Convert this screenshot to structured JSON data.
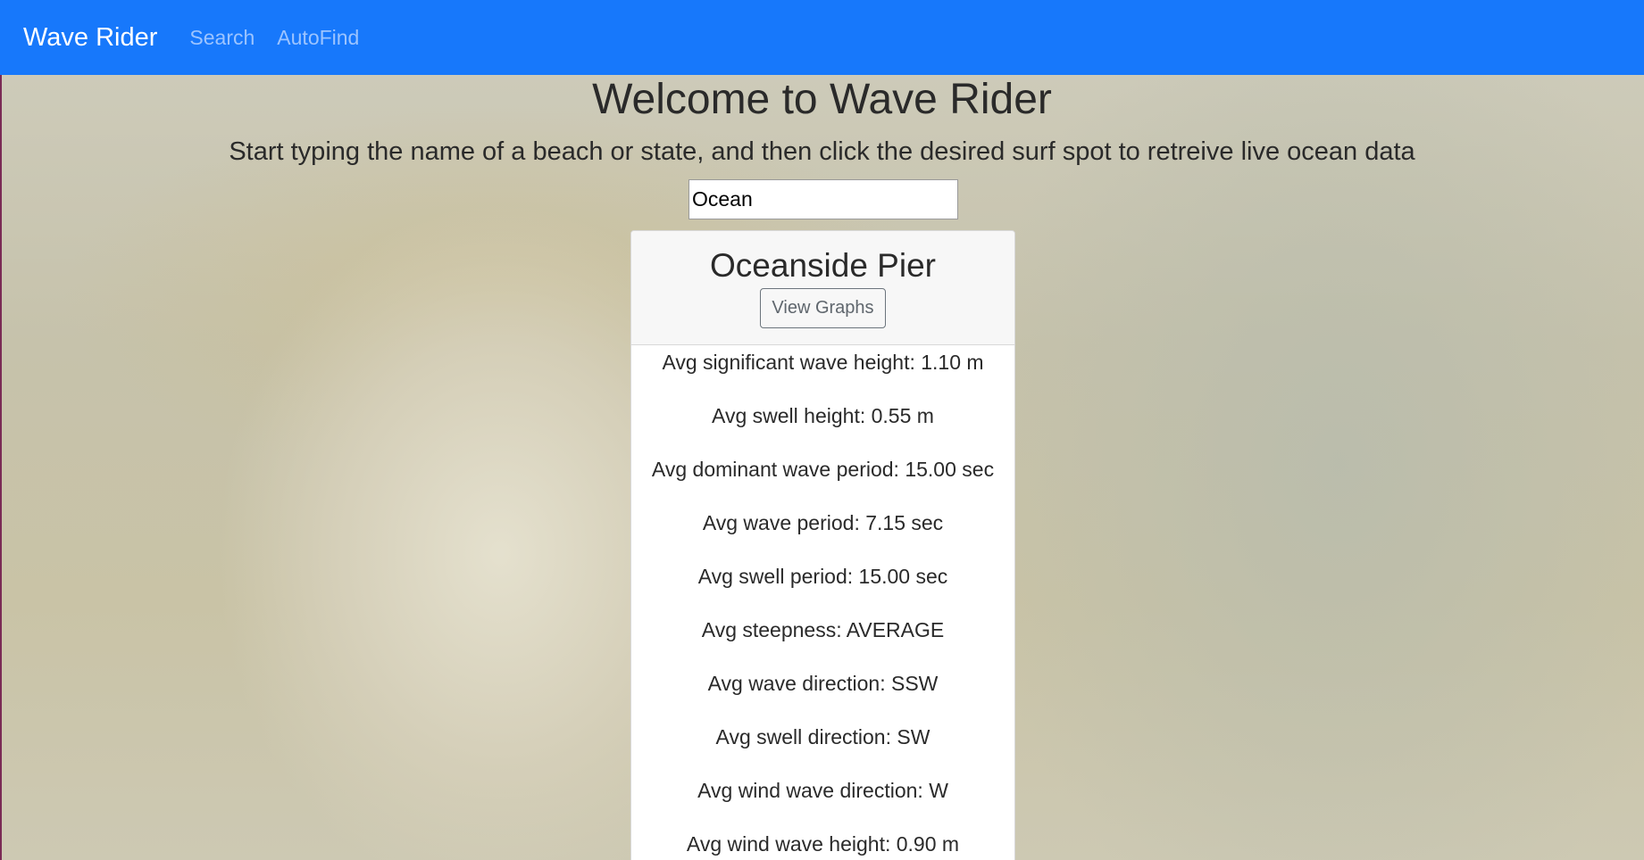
{
  "navbar": {
    "brand": "Wave Rider",
    "links": [
      "Search",
      "AutoFind"
    ]
  },
  "page": {
    "title": "Welcome to Wave Rider",
    "subtitle": "Start typing the name of a beach or state, and then click the desired surf spot to retreive live ocean data"
  },
  "search": {
    "value": "Ocean"
  },
  "result": {
    "name": "Oceanside Pier",
    "button_label": "View Graphs",
    "stats": [
      "Avg significant wave height: 1.10 m",
      "Avg swell height: 0.55 m",
      "Avg dominant wave period: 15.00 sec",
      "Avg wave period: 7.15 sec",
      "Avg swell period: 15.00 sec",
      "Avg steepness: AVERAGE",
      "Avg wave direction: SSW",
      "Avg swell direction: SW",
      "Avg wind wave direction: W",
      "Avg wind wave height: 0.90 m"
    ]
  },
  "colors": {
    "navbar": "#1778fb",
    "brand_text": "#ffffff",
    "nav_link": "#9cc4ff"
  }
}
